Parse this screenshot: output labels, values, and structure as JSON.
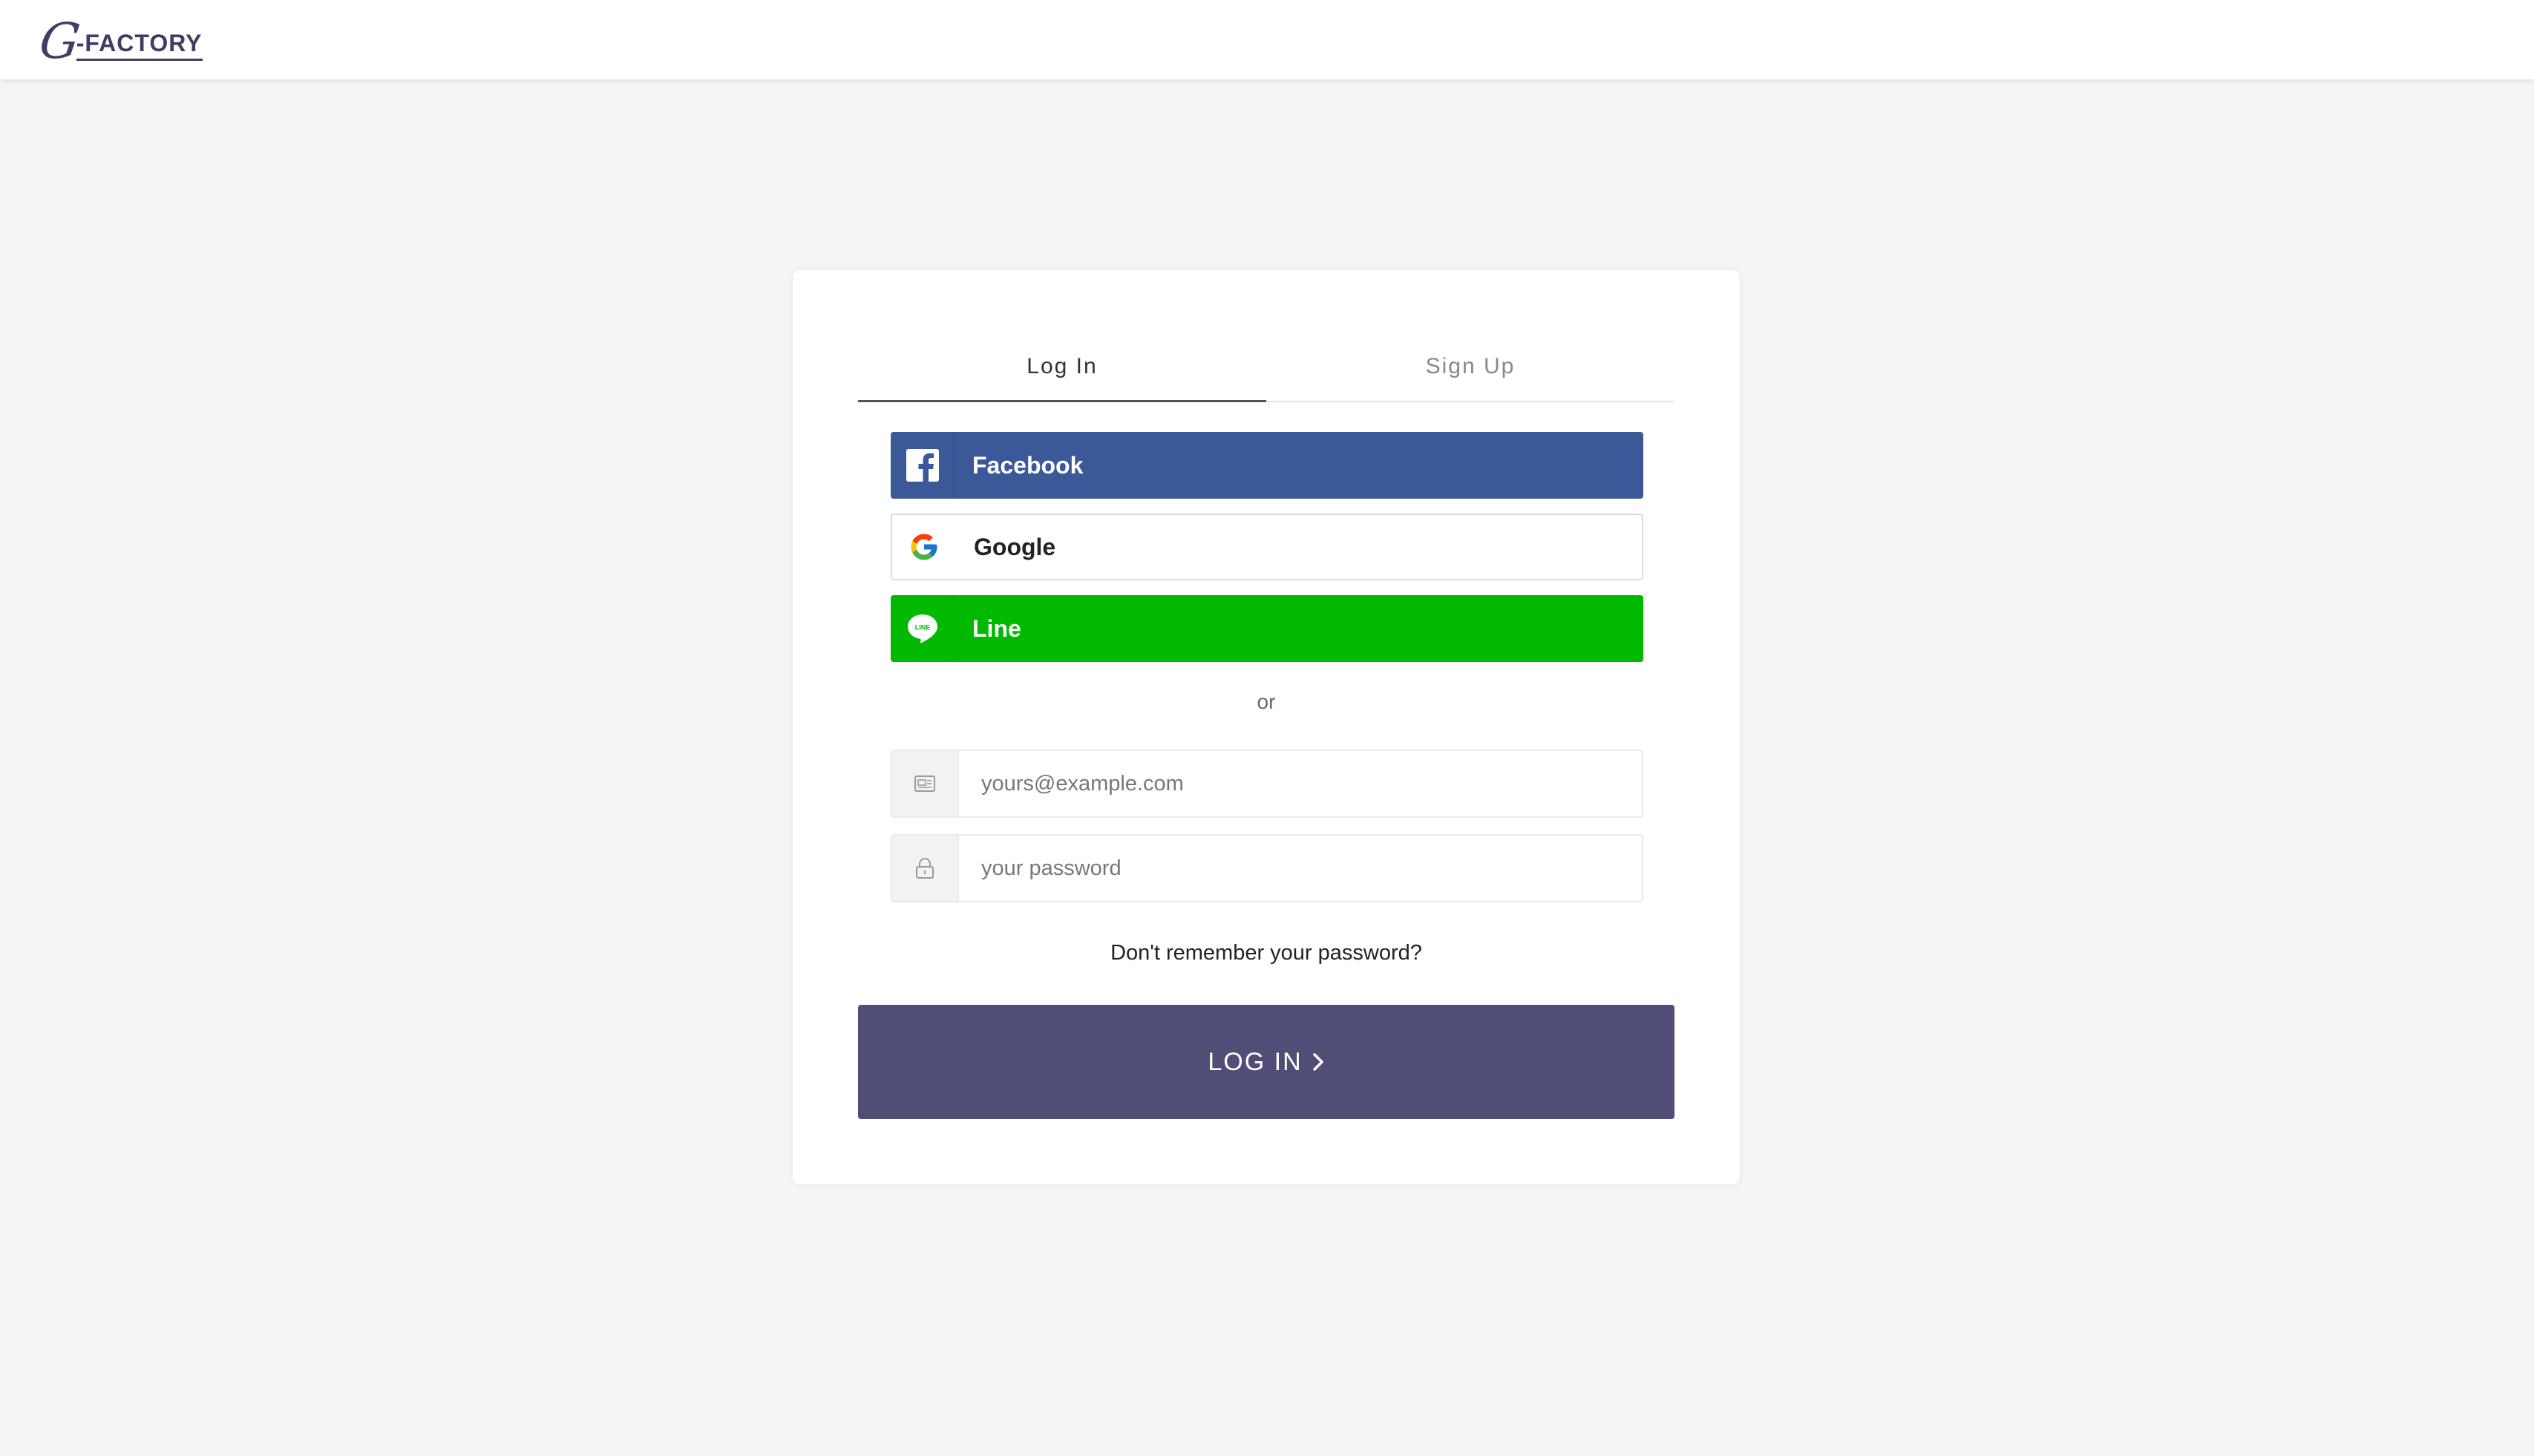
{
  "header": {
    "logo_initial": "G",
    "logo_text": "-FACTORY",
    "logo_alt": "G-FACTORY"
  },
  "tabs": [
    {
      "label": "Log In",
      "active": true
    },
    {
      "label": "Sign Up",
      "active": false
    }
  ],
  "social": {
    "facebook": {
      "label": "Facebook",
      "color": "#3b5998",
      "icon": "facebook-icon"
    },
    "google": {
      "label": "Google",
      "color": "#ffffff",
      "icon": "google-icon"
    },
    "line": {
      "label": "Line",
      "color": "#00b900",
      "icon": "line-icon"
    }
  },
  "divider_text": "or",
  "email": {
    "placeholder": "yours@example.com",
    "value": "",
    "icon": "email-icon"
  },
  "password": {
    "placeholder": "your password",
    "value": "",
    "icon": "lock-icon"
  },
  "forgot_label": "Don't remember your password?",
  "submit": {
    "label": "LOG IN",
    "color": "#504e77",
    "icon": "chevron-right-icon"
  }
}
